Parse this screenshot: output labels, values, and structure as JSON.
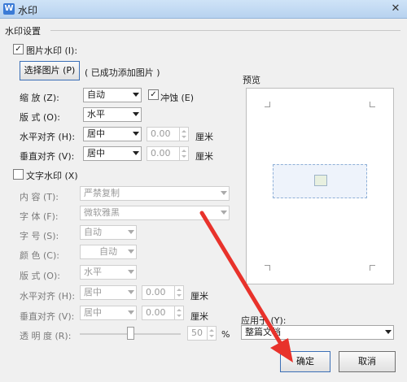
{
  "window": {
    "app_icon": "W",
    "title": "水印",
    "close_icon": "close-icon"
  },
  "section": {
    "title": "水印设置"
  },
  "picture_watermark": {
    "label": "图片水印 (I):",
    "checked": true,
    "select_button": "选择图片 (P)",
    "status": "( 已成功添加图片 )",
    "scale_label": "缩    放 (Z):",
    "scale_value": "自动",
    "washout_label": "冲蚀 (E)",
    "washout_checked": true,
    "layout_label": "版    式 (O):",
    "layout_value": "水平",
    "h_align_label": "水平对齐 (H):",
    "h_align_value": "居中",
    "h_offset": "0.00",
    "h_unit": "厘米",
    "v_align_label": "垂直对齐 (V):",
    "v_align_value": "居中",
    "v_offset": "0.00",
    "v_unit": "厘米"
  },
  "text_watermark": {
    "label": "文字水印 (X)",
    "checked": false,
    "content_label": "内    容 (T):",
    "content_value": "严禁复制",
    "font_label": "字    体 (F):",
    "font_value": "微软雅黑",
    "size_label": "字    号 (S):",
    "size_value": "自动",
    "color_label": "颜    色 (C):",
    "color_value": "自动",
    "layout_label": "版    式 (O):",
    "layout_value": "水平",
    "h_align_label": "水平对齐 (H):",
    "h_align_value": "居中",
    "h_offset": "0.00",
    "h_unit": "厘米",
    "v_align_label": "垂直对齐 (V):",
    "v_align_value": "居中",
    "v_offset": "0.00",
    "v_unit": "厘米",
    "transparency_label": "透 明 度 (R):",
    "transparency_percent": 50,
    "transparency_value": "50",
    "percent_sign": "%"
  },
  "preview": {
    "label": "预览"
  },
  "apply_to": {
    "label": "应用于 (Y):",
    "value": "整篇文档"
  },
  "buttons": {
    "ok": "确定",
    "cancel": "取消"
  },
  "colors": {
    "annotation_arrow": "#e8322b",
    "title_bar": "#c2daf3"
  }
}
